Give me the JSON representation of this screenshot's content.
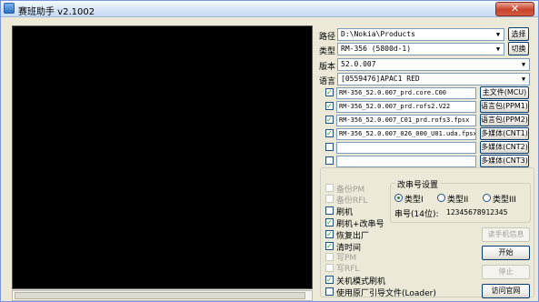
{
  "window": {
    "title": "赛班助手 v2.1002",
    "close_glyph": "✕"
  },
  "path": {
    "label": "路径",
    "value": "D:\\Nokia\\Products",
    "button": "选择"
  },
  "type": {
    "label": "类型",
    "value": "RM-356   (5800d-1)",
    "button": "切换"
  },
  "version": {
    "label": "版本",
    "value": "52.0.007"
  },
  "language": {
    "label": "语言",
    "value": "[0559476]APAC1 RED"
  },
  "files": [
    {
      "checked": true,
      "name": "RM-356_52.0.007_prd.core.C00",
      "button": "主文件(MCU)"
    },
    {
      "checked": true,
      "name": "RM-356_52.0.007_prd.rofs2.V22",
      "button": "语言包(PPM1)"
    },
    {
      "checked": true,
      "name": "RM-356_52.0.007_C01_prd.rofs3.fpsx",
      "button": "语言包(PPM2)"
    },
    {
      "checked": true,
      "name": "RM-356_52.0.007_026_000_U01.uda.fpsx",
      "button": "多媒体(CNT1)"
    },
    {
      "checked": false,
      "name": "",
      "button": "多媒体(CNT2)"
    },
    {
      "checked": false,
      "name": "",
      "button": "多媒体(CNT3)"
    }
  ],
  "options": [
    {
      "label": "备份PM",
      "checked": false,
      "enabled": false
    },
    {
      "label": "备份RFL",
      "checked": false,
      "enabled": false
    },
    {
      "label": "刷机",
      "checked": false,
      "enabled": true
    },
    {
      "label": "刷机+改串号",
      "checked": true,
      "enabled": true
    },
    {
      "label": "恢复出厂",
      "checked": true,
      "enabled": true
    },
    {
      "label": "清时间",
      "checked": true,
      "enabled": true
    },
    {
      "label": "写PM",
      "checked": false,
      "enabled": false
    },
    {
      "label": "写RFL",
      "checked": false,
      "enabled": false
    },
    {
      "label": "关机模式刷机",
      "checked": true,
      "enabled": true
    },
    {
      "label": "使用原厂引导文件(Loader)",
      "checked": false,
      "enabled": true
    }
  ],
  "serial": {
    "group_title": "改串号设置",
    "radios": [
      {
        "label": "类型I",
        "selected": true
      },
      {
        "label": "类型II",
        "selected": false
      },
      {
        "label": "类型III",
        "selected": false
      }
    ],
    "field_label": "串号(14位):",
    "field_value": "12345678912345"
  },
  "actions": {
    "read_info": "读手机信息",
    "start": "开始",
    "stop": "停止",
    "website": "访问官网"
  }
}
